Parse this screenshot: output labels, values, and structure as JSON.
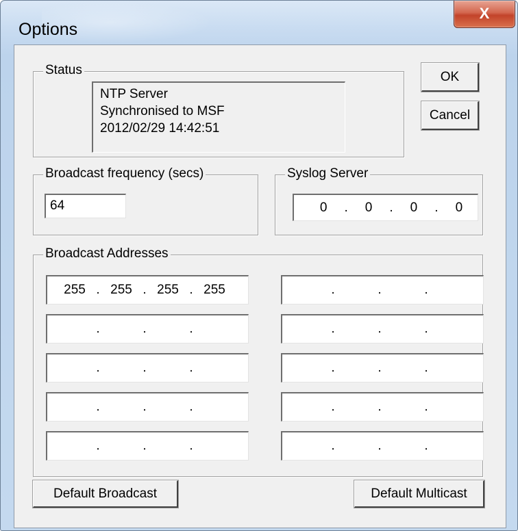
{
  "window": {
    "title": "Options",
    "close_label": "X"
  },
  "status": {
    "group_label": "Status",
    "lines": [
      "NTP Server",
      "Synchronised to MSF",
      "2012/02/29 14:42:51"
    ]
  },
  "buttons": {
    "ok": "OK",
    "cancel": "Cancel",
    "default_broadcast": "Default Broadcast",
    "default_multicast": "Default Multicast"
  },
  "broadcast_frequency": {
    "group_label": "Broadcast frequency (secs)",
    "value": "64"
  },
  "syslog": {
    "group_label": "Syslog Server",
    "octets": [
      "0",
      "0",
      "0",
      "0"
    ]
  },
  "broadcast_addresses": {
    "group_label": "Broadcast Addresses",
    "left": [
      [
        "255",
        "255",
        "255",
        "255"
      ],
      [
        "",
        "",
        "",
        ""
      ],
      [
        "",
        "",
        "",
        ""
      ],
      [
        "",
        "",
        "",
        ""
      ],
      [
        "",
        "",
        "",
        ""
      ]
    ],
    "right": [
      [
        "",
        "",
        "",
        ""
      ],
      [
        "",
        "",
        "",
        ""
      ],
      [
        "",
        "",
        "",
        ""
      ],
      [
        "",
        "",
        "",
        ""
      ],
      [
        "",
        "",
        "",
        ""
      ]
    ]
  }
}
